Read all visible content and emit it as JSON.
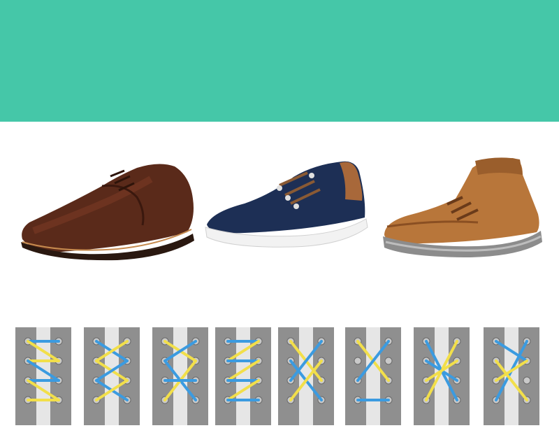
{
  "colors": {
    "banner": "#45c7a8",
    "background": "#ffffff",
    "lacing_panel": "#8f8f8f",
    "lacing_gap": "#e6e6e6",
    "lace_blue": "#3b9be0",
    "lace_yellow": "#f2df4a",
    "eyelet": "#c9c9c9"
  },
  "shoes": [
    {
      "icon": "brown-leather-oxford-shoe",
      "upper": "#5a2a1a",
      "sole": "#2a1810"
    },
    {
      "icon": "navy-suede-sneaker",
      "upper": "#1d2f55",
      "sole": "#f2f2f2"
    },
    {
      "icon": "tan-leather-boot",
      "upper": "#b8763a",
      "sole": "#8c8c8c"
    }
  ],
  "lacing_patterns": [
    {
      "name": "straight-bar-lacing"
    },
    {
      "name": "ladder-lacing"
    },
    {
      "name": "criss-cross-lacing"
    },
    {
      "name": "straight-european-lacing"
    },
    {
      "name": "double-cross-lacing"
    },
    {
      "name": "skip-lacing"
    },
    {
      "name": "lattice-lacing"
    },
    {
      "name": "zig-zag-lacing"
    }
  ]
}
